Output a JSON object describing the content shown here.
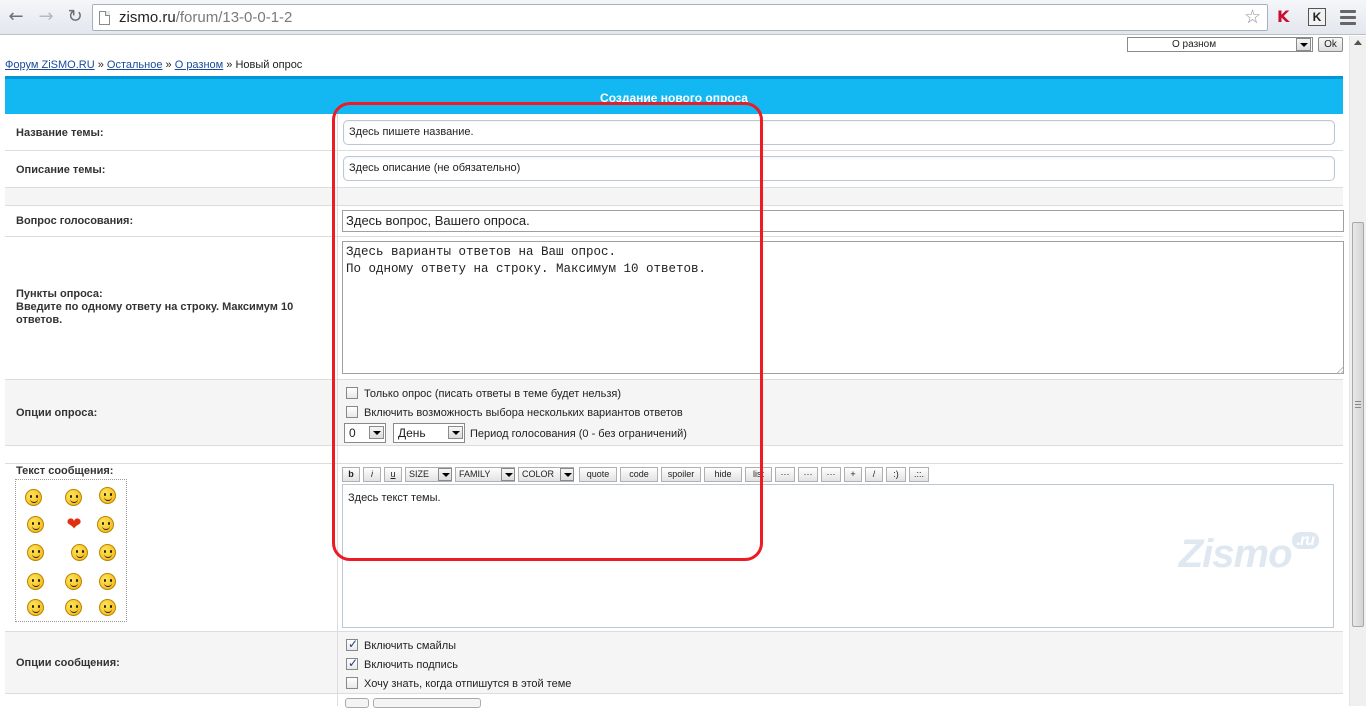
{
  "browser": {
    "url_host": "zismo.ru",
    "url_path": "/forum/13-0-0-1-2",
    "ext_kaspersky": "K",
    "ext_k": "K"
  },
  "jump": {
    "selected": "О разном",
    "ok_label": "Ok"
  },
  "breadcrumb": {
    "items": [
      "Форум ZiSMO.RU",
      "Остальное",
      "О разном"
    ],
    "separator": "»",
    "current": "Новый опрос"
  },
  "form": {
    "header": "Создание нового опроса",
    "topic_title": {
      "label": "Название темы:",
      "value": "Здесь пишете название."
    },
    "topic_desc": {
      "label": "Описание темы:",
      "value": "Здесь описание (не обязательно)"
    },
    "poll_question": {
      "label": "Вопрос голосования:",
      "value": "Здесь вопрос, Вашего опроса."
    },
    "poll_items": {
      "label": "Пункты опроса:",
      "hint": "Введите по одному ответу на строку. Максимум 10 ответов.",
      "value": "Здесь варианты ответов на Ваш опрос.\nПо одному ответу на строку. Максимум 10 ответов."
    },
    "poll_options": {
      "label": "Опции опроса:",
      "only_poll": "Только опрос (писать ответы в теме будет нельзя)",
      "multi": "Включить возможность выбора нескольких вариантов ответов",
      "period_value": "0",
      "period_unit": "День",
      "period_text": "Период голосования (0 - без ограничений)"
    },
    "message": {
      "label": "Текст сообщения:",
      "value": "Здесь текст темы.",
      "watermark": "Zismo",
      "watermark_sup": ".ru"
    },
    "toolbar": {
      "b": "b",
      "i": "i",
      "u": "u",
      "size": "SIZE",
      "family": "FAMILY",
      "color": "COLOR",
      "quote": "quote",
      "code": "code",
      "spoiler": "spoiler",
      "hide": "hide",
      "list": "list",
      "dots1": "···",
      "dots2": "···",
      "dots3": "···",
      "plus": "+",
      "slash": "/",
      "smile": ":)",
      "more": ".::."
    },
    "msg_options": {
      "label": "Опции сообщения:",
      "smiles": "Включить смайлы",
      "signature": "Включить подпись",
      "notify": "Хочу знать, когда отпишутся в этой теме"
    }
  },
  "colors": {
    "header_bg": "#13b7f2",
    "highlight": "#ec1b24",
    "link": "#1a4a9c"
  }
}
